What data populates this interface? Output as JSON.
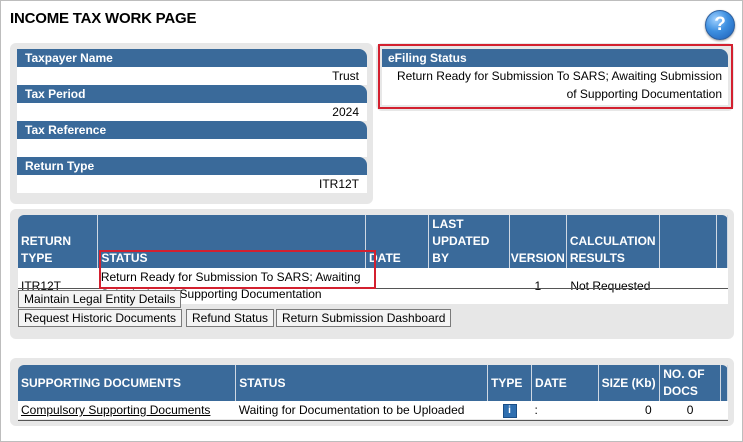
{
  "page": {
    "title": "INCOME TAX WORK PAGE",
    "help_glyph": "?"
  },
  "taxpayer": {
    "name_label": "Taxpayer Name",
    "name_value": "Trust",
    "period_label": "Tax Period",
    "period_value": "2024",
    "reference_label": "Tax Reference",
    "reference_value": "",
    "return_type_label": "Return Type",
    "return_type_value": "ITR12T"
  },
  "efiling": {
    "label": "eFiling Status",
    "status_line1": "Return Ready for Submission To SARS; Awaiting Submission",
    "status_line2": "of Supporting Documentation"
  },
  "returns_table": {
    "headers": {
      "return_type_1": "RETURN",
      "return_type_2": "TYPE",
      "status": "STATUS",
      "date": "DATE",
      "last_updated_1": "LAST",
      "last_updated_2": "UPDATED BY",
      "version": "VERSION",
      "calc_1": "CALCULATION",
      "calc_2": "RESULTS"
    },
    "row": {
      "return_type": "ITR12T",
      "status_line1": "Return Ready for Submission To SARS; Awaiting",
      "status_line2": "Submission of Supporting Documentation",
      "date": "",
      "last_updated_by": "",
      "version": "1",
      "calculation_results": "Not Requested"
    }
  },
  "buttons": {
    "maintain_entity": "Maintain Legal Entity Details",
    "historic_docs": "Request Historic Documents",
    "refund_status": "Refund Status",
    "submission_dashboard": "Return Submission Dashboard"
  },
  "supporting_table": {
    "headers": {
      "documents": "SUPPORTING DOCUMENTS",
      "status": "STATUS",
      "type": "TYPE",
      "date": "DATE",
      "size": "SIZE (Kb)",
      "docs_1": "NO. OF",
      "docs_2": "DOCS"
    },
    "row": {
      "name": "Compulsory Supporting Documents",
      "status": "Waiting for Documentation to be Uploaded",
      "type_icon": "info-icon",
      "type_glyph": "i",
      "date": ":",
      "size": "0",
      "docs": "0"
    }
  },
  "colors": {
    "header_blue": "#3a6a9a",
    "highlight_red": "#d3202f",
    "panel_grey": "#e7e7e7"
  }
}
